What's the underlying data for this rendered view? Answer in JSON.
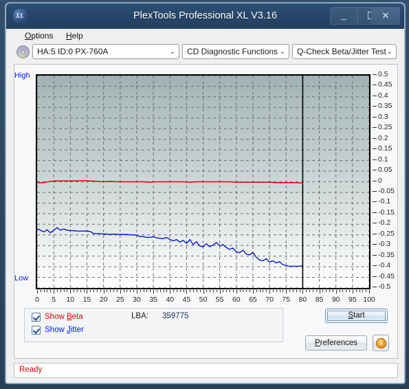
{
  "window": {
    "title": "PlexTools Professional XL V3.16",
    "app_icon": "XL",
    "minimize": "–",
    "maximize": "□",
    "close": "✕"
  },
  "menubar": {
    "items": [
      {
        "label": "Options",
        "accel": "O"
      },
      {
        "label": "Help",
        "accel": "H"
      }
    ]
  },
  "toolbar": {
    "drive_combo": {
      "value": "HA:5 ID:0  PX-760A",
      "arrow": "⌄"
    },
    "function_combo": {
      "value": "CD Diagnostic Functions",
      "arrow": "⌄"
    },
    "test_combo": {
      "value": "Q-Check Beta/Jitter Test",
      "arrow": "⌄"
    }
  },
  "options": {
    "show_beta": {
      "label": "Show Beta",
      "checked": true,
      "color": "#e60000"
    },
    "show_jitter": {
      "label": "Show Jitter",
      "checked": true,
      "color": "#0017ff"
    },
    "lba_label": "LBA:",
    "lba_value": "359775"
  },
  "buttons": {
    "start": "Start",
    "preferences": "Preferences",
    "info": "i"
  },
  "status": {
    "text": "Ready"
  },
  "chart_data": {
    "type": "line",
    "title": "",
    "xlabel": "",
    "ylabel": "",
    "axis_high_label": "High",
    "axis_low_label": "Low",
    "xlim": [
      0,
      100
    ],
    "ylim": [
      -0.5,
      0.5
    ],
    "xticks": [
      0,
      5,
      10,
      15,
      20,
      25,
      30,
      35,
      40,
      45,
      50,
      55,
      60,
      65,
      70,
      75,
      80,
      85,
      90,
      95,
      100
    ],
    "yticks": [
      0.5,
      0.45,
      0.4,
      0.35,
      0.3,
      0.25,
      0.2,
      0.15,
      0.1,
      0.05,
      0,
      -0.05,
      -0.1,
      -0.15,
      -0.2,
      -0.25,
      -0.3,
      -0.35,
      -0.4,
      -0.45,
      -0.5
    ],
    "grid": true,
    "grid_style": "dashed",
    "grid_color": "#6b6b6b",
    "plot_bg_gradient": [
      "#9fb1b3",
      "#ffffff"
    ],
    "data_end_marker_x": 80,
    "legend_position": "below-plot",
    "series": [
      {
        "name": "Beta",
        "color": "#e60000",
        "x": [
          0,
          2,
          4,
          5,
          6,
          8,
          10,
          12,
          14,
          16,
          18,
          20,
          22,
          24,
          26,
          28,
          30,
          32,
          34,
          36,
          38,
          40,
          42,
          44,
          46,
          48,
          50,
          52,
          54,
          56,
          58,
          60,
          62,
          64,
          66,
          68,
          70,
          72,
          74,
          76,
          78,
          80
        ],
        "values": [
          -0.004,
          -0.004,
          0.002,
          0.004,
          0.004,
          0.004,
          0.004,
          0.004,
          0.006,
          0.004,
          0.002,
          0.0,
          0.002,
          0.0,
          0.0,
          0.0,
          0.0,
          0.0,
          -0.002,
          0.0,
          0.0,
          0.0,
          0.0,
          0.0,
          -0.002,
          0.0,
          0.0,
          0.0,
          0.0,
          0.0,
          0.0,
          -0.002,
          -0.002,
          -0.002,
          -0.002,
          -0.002,
          -0.002,
          -0.004,
          -0.004,
          -0.004,
          -0.004,
          -0.006
        ]
      },
      {
        "name": "Jitter",
        "color": "#0019d4",
        "x": [
          0,
          1,
          2,
          3,
          4,
          5,
          6,
          7,
          8,
          9,
          10,
          11,
          12,
          13,
          14,
          15,
          16,
          17,
          18,
          19,
          20,
          21,
          22,
          23,
          24,
          25,
          26,
          27,
          28,
          29,
          30,
          31,
          32,
          33,
          34,
          35,
          36,
          37,
          38,
          39,
          40,
          41,
          42,
          43,
          44,
          45,
          46,
          47,
          48,
          49,
          50,
          51,
          52,
          53,
          54,
          55,
          56,
          57,
          58,
          59,
          60,
          61,
          62,
          63,
          64,
          65,
          66,
          67,
          68,
          69,
          70,
          71,
          72,
          73,
          74,
          75,
          76,
          77,
          78,
          79,
          80
        ],
        "values": [
          -0.222,
          -0.228,
          -0.236,
          -0.226,
          -0.24,
          -0.228,
          -0.216,
          -0.228,
          -0.222,
          -0.228,
          -0.23,
          -0.23,
          -0.232,
          -0.232,
          -0.232,
          -0.232,
          -0.234,
          -0.244,
          -0.244,
          -0.244,
          -0.246,
          -0.246,
          -0.248,
          -0.246,
          -0.248,
          -0.248,
          -0.248,
          -0.248,
          -0.25,
          -0.25,
          -0.252,
          -0.258,
          -0.258,
          -0.262,
          -0.262,
          -0.258,
          -0.264,
          -0.266,
          -0.268,
          -0.262,
          -0.272,
          -0.278,
          -0.272,
          -0.284,
          -0.276,
          -0.29,
          -0.272,
          -0.296,
          -0.282,
          -0.302,
          -0.306,
          -0.292,
          -0.306,
          -0.298,
          -0.286,
          -0.302,
          -0.296,
          -0.31,
          -0.318,
          -0.312,
          -0.33,
          -0.334,
          -0.322,
          -0.34,
          -0.344,
          -0.332,
          -0.356,
          -0.368,
          -0.372,
          -0.362,
          -0.378,
          -0.372,
          -0.382,
          -0.376,
          -0.39,
          -0.394,
          -0.398,
          -0.398,
          -0.398,
          -0.398,
          -0.394
        ]
      }
    ]
  }
}
